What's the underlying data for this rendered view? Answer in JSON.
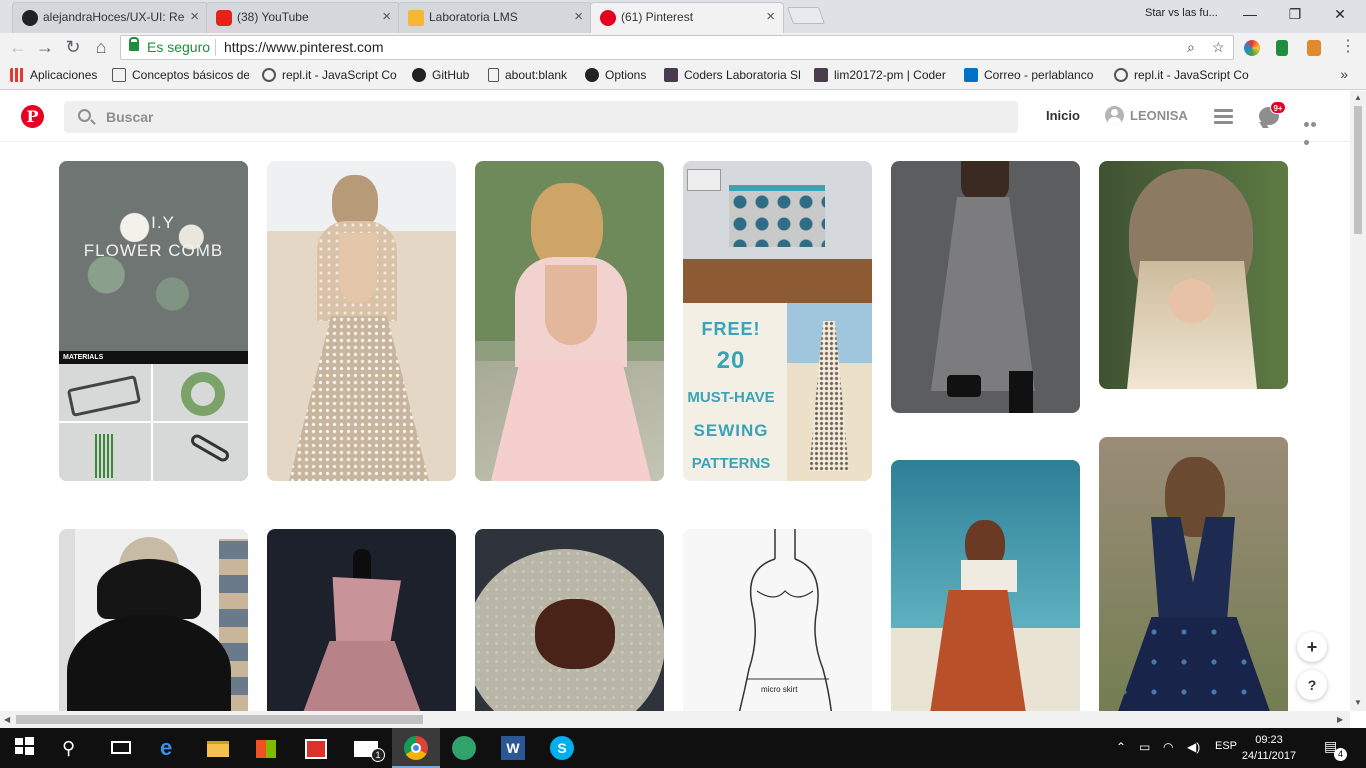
{
  "browser": {
    "tabs": [
      {
        "title": "alejandraHoces/UX-UI: Re",
        "icon": "github-icon"
      },
      {
        "title": "(38) YouTube",
        "icon": "youtube-icon"
      },
      {
        "title": "Laboratoria LMS",
        "icon": "laboratoria-icon"
      },
      {
        "title": "(61) Pinterest",
        "icon": "pinterest-icon",
        "active": true
      }
    ],
    "window_title": "Star vs las fu...",
    "secure_label": "Es seguro",
    "url": "https://www.pinterest.com",
    "bookmarks": [
      {
        "label": "Aplicaciones",
        "icon": "apps-icon"
      },
      {
        "label": "Conceptos básicos de",
        "icon": "page-icon"
      },
      {
        "label": "repl.it - JavaScript Co",
        "icon": "replit-icon"
      },
      {
        "label": "GitHub",
        "icon": "github-icon"
      },
      {
        "label": "about:blank",
        "icon": "page-icon"
      },
      {
        "label": "Options",
        "icon": "github-icon"
      },
      {
        "label": "Coders Laboratoria Sl",
        "icon": "slack-icon"
      },
      {
        "label": "lim20172-pm | Coder",
        "icon": "slack-icon"
      },
      {
        "label": "Correo - perlablanco",
        "icon": "outlook-icon"
      },
      {
        "label": "repl.it - JavaScript Co",
        "icon": "replit-icon"
      }
    ],
    "bookmarks_more": "»"
  },
  "pinterest": {
    "logo": "P",
    "search_placeholder": "Buscar",
    "home_label": "Inicio",
    "username": "LEONISA",
    "notifications_badge": "9+"
  },
  "pins": [
    {
      "name": "pin-flower-comb",
      "text_lines": [
        "D.I.Y",
        "FLOWER COMB"
      ],
      "caption": "MATERIALS",
      "bg": "#6b7270"
    },
    {
      "name": "pin-sequin-dress",
      "bg": "#d9c9b4"
    },
    {
      "name": "pin-pink-dress",
      "bg": "#c6b9a8"
    },
    {
      "name": "pin-sewing-patterns",
      "text_lines": [
        "FREE!",
        "20",
        "MUST-HAVE",
        "SEWING",
        "PATTERNS"
      ],
      "bg": "#f3efe5"
    },
    {
      "name": "pin-gray-dress",
      "bg": "#5c5d5f"
    },
    {
      "name": "pin-braid-hair",
      "bg": "#3e5131"
    },
    {
      "name": "pin-black-dress",
      "bg": "#1b1b1f"
    },
    {
      "name": "pin-mauve-gown",
      "bg": "#1a1f2a"
    },
    {
      "name": "pin-chocolate-cookie",
      "bg": "#2b2f38"
    },
    {
      "name": "pin-skirt-sketch",
      "caption": "micro skirt",
      "bg": "#f7f7f7"
    },
    {
      "name": "pin-orange-dress",
      "bg": "#2e7f96"
    },
    {
      "name": "pin-navy-gown",
      "bg": "#8b7c6a"
    }
  ],
  "floating": {
    "add": "+",
    "help": "?"
  },
  "taskbar": {
    "language": "ESP",
    "time": "09:23",
    "date": "24/11/2017",
    "notifications": "4",
    "mail_count": "1"
  },
  "colors": {
    "pinterest_red": "#e60023",
    "secure_green": "#1e8e3e",
    "taskbar": "#101010"
  }
}
